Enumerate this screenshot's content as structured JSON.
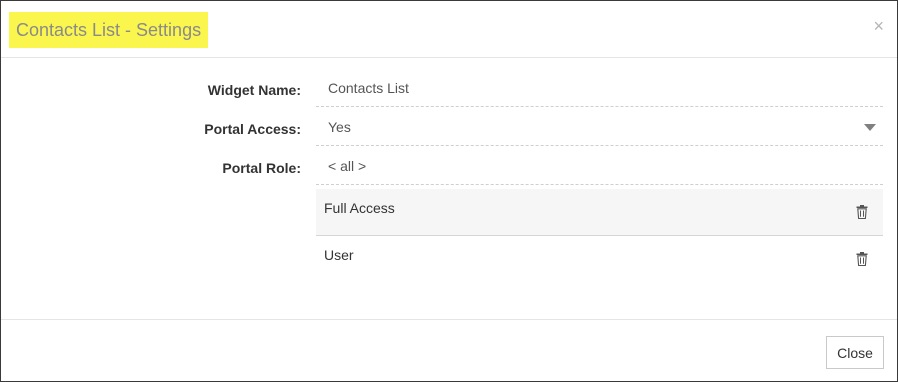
{
  "dialog": {
    "title": "Contacts List - Settings",
    "close_symbol": "×",
    "close_icon": "close-icon"
  },
  "form": {
    "widget_name": {
      "label": "Widget Name:",
      "value": "Contacts List"
    },
    "portal_access": {
      "label": "Portal Access:",
      "value": "Yes",
      "icon": "caret-down-icon"
    },
    "portal_role": {
      "label": "Portal Role:",
      "placeholder": "< all >"
    }
  },
  "roles": {
    "items": [
      {
        "label": "Full Access",
        "icon": "trash-icon"
      },
      {
        "label": "User",
        "icon": "trash-icon"
      }
    ]
  },
  "footer": {
    "close_label": "Close"
  },
  "colors": {
    "title_highlight": "#fbf64e",
    "border": "#3a3a3a"
  }
}
